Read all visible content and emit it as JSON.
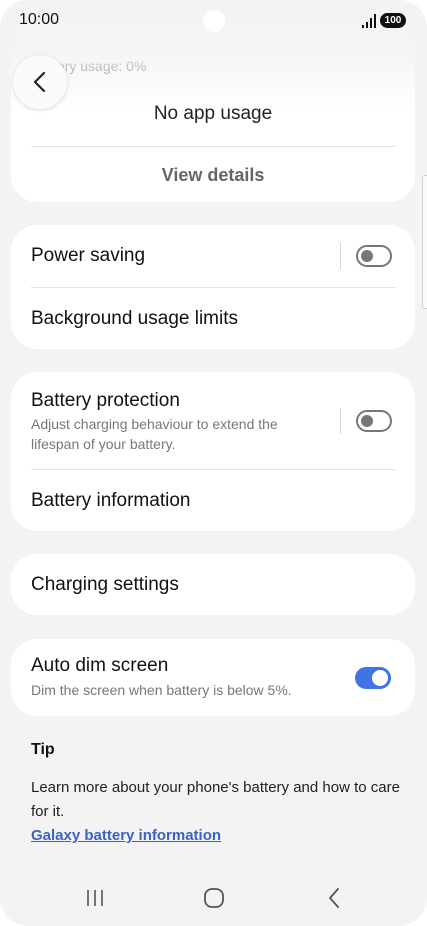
{
  "status_bar": {
    "time": "10:00",
    "battery_level": "100",
    "signal_icon": "signal-icon"
  },
  "header": {
    "back_icon": "chevron-left-icon"
  },
  "usage_card": {
    "label": "Battery usage: 0%",
    "no_usage_text": "No app usage",
    "view_details": "View details"
  },
  "power_card": {
    "power_saving": {
      "title": "Power saving",
      "enabled": false
    },
    "background_limits": {
      "title": "Background usage limits"
    }
  },
  "protection_card": {
    "battery_protection": {
      "title": "Battery protection",
      "subtitle": "Adjust charging behaviour to extend the lifespan of your battery.",
      "enabled": false
    },
    "battery_information": {
      "title": "Battery information"
    }
  },
  "charging_card": {
    "title": "Charging settings"
  },
  "auto_dim_card": {
    "title": "Auto dim screen",
    "subtitle": "Dim the screen when battery is below 5%.",
    "enabled": true
  },
  "tip": {
    "heading": "Tip",
    "body": "Learn more about your phone's battery and how to care for it.",
    "link": "Galaxy battery information"
  },
  "nav_bar": {
    "recents_icon": "recents-icon",
    "home_icon": "home-icon",
    "back_icon": "back-icon"
  },
  "colors": {
    "accent": "#3f73e6",
    "link": "#3a63c9",
    "background": "#f3f3f3",
    "card": "#ffffff"
  }
}
